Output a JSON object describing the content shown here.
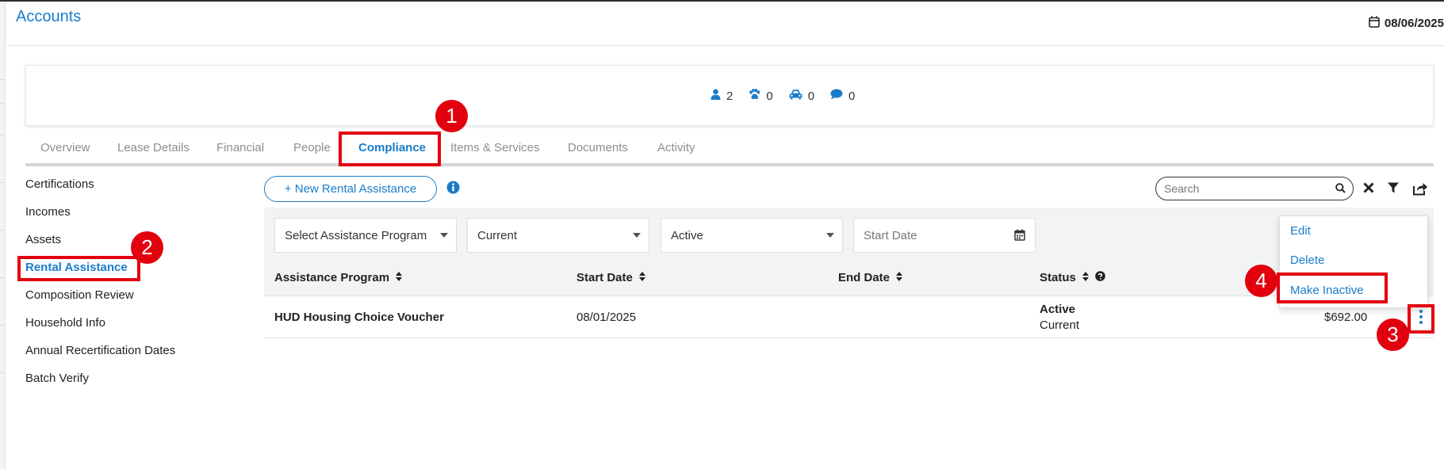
{
  "header": {
    "title": "Accounts",
    "date": "08/06/2025"
  },
  "summary": {
    "people_count": "2",
    "pets_count": "0",
    "vehicles_count": "0",
    "messages_count": "0"
  },
  "tabs": [
    {
      "label": "Overview"
    },
    {
      "label": "Lease Details"
    },
    {
      "label": "Financial"
    },
    {
      "label": "People"
    },
    {
      "label": "Compliance"
    },
    {
      "label": "Items & Services"
    },
    {
      "label": "Documents"
    },
    {
      "label": "Activity"
    }
  ],
  "sidebar": {
    "items": [
      {
        "label": "Certifications"
      },
      {
        "label": "Incomes"
      },
      {
        "label": "Assets"
      },
      {
        "label": "Rental Assistance"
      },
      {
        "label": "Composition Review"
      },
      {
        "label": "Household Info"
      },
      {
        "label": "Annual Recertification Dates"
      },
      {
        "label": "Batch Verify"
      }
    ]
  },
  "toolbar": {
    "new_label": "+ New Rental Assistance",
    "search_placeholder": "Search"
  },
  "filters": {
    "program": "Select Assistance Program",
    "period": "Current",
    "status": "Active",
    "start_date_placeholder": "Start Date"
  },
  "table": {
    "headers": {
      "program": "Assistance Program",
      "start": "Start Date",
      "end": "End Date",
      "status": "Status"
    },
    "rows": [
      {
        "program": "HUD Housing Choice Voucher",
        "start": "08/01/2025",
        "end": "",
        "status": "Active",
        "substatus": "Current",
        "amount": "$692.00"
      }
    ]
  },
  "row_menu": {
    "edit": "Edit",
    "delete": "Delete",
    "make_inactive": "Make Inactive"
  },
  "annotations": {
    "b1": "1",
    "b2": "2",
    "b3": "3",
    "b4": "4"
  },
  "colors": {
    "accent": "#1a7cc9",
    "highlight": "#e2000f"
  }
}
